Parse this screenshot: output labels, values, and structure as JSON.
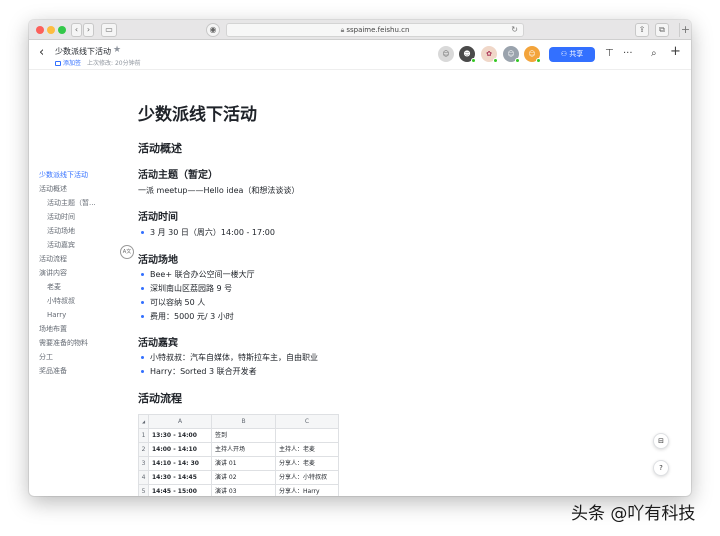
{
  "browser": {
    "url": "sspaime.feishu.cn"
  },
  "header": {
    "title": "少数派线下活动",
    "tag": "添加签",
    "last_modified": "上次修改: 20分钟前",
    "share_label": "共享"
  },
  "outline": [
    {
      "label": "少数派线下活动",
      "level": 1,
      "active": true
    },
    {
      "label": "活动概述",
      "level": 1
    },
    {
      "label": "活动主题（暂...",
      "level": 2
    },
    {
      "label": "活动时间",
      "level": 2
    },
    {
      "label": "活动场地",
      "level": 2
    },
    {
      "label": "活动嘉宾",
      "level": 2
    },
    {
      "label": "活动流程",
      "level": 1
    },
    {
      "label": "演讲内容",
      "level": 1
    },
    {
      "label": "老麦",
      "level": 2
    },
    {
      "label": "小特叔叔",
      "level": 2
    },
    {
      "label": "Harry",
      "level": 2
    },
    {
      "label": "场地布置",
      "level": 1
    },
    {
      "label": "需要准备的物料",
      "level": 1
    },
    {
      "label": "分工",
      "level": 1
    },
    {
      "label": "奖品准备",
      "level": 1
    }
  ],
  "doc": {
    "title": "少数派线下活动",
    "overview_heading": "活动概述",
    "theme_heading": "活动主题（暂定）",
    "theme_text": "一派 meetup——Hello idea（和想法谈谈）",
    "time_heading": "活动时间",
    "time_text": "3 月 30 日（周六）14:00 - 17:00",
    "venue_heading": "活动场地",
    "venue_items": [
      "Bee+ 联合办公空间一楼大厅",
      "深圳南山区荔园路 9 号",
      "可以容纳 50 人",
      "费用：5000 元/ 3 小时"
    ],
    "guests_heading": "活动嘉宾",
    "guest_items": [
      "小特叔叔：汽车自媒体，特斯拉车主，自由职业",
      "Harry：Sorted 3 联合开发者"
    ],
    "flow_heading": "活动流程",
    "ai_badge": "A文"
  },
  "sheet": {
    "columns": [
      "A",
      "B",
      "C"
    ],
    "rows": [
      {
        "n": "1",
        "a": "13:30 - 14:00",
        "b": "签到",
        "c": ""
      },
      {
        "n": "2",
        "a": "14:00 - 14:10",
        "b": "主持人开场",
        "c": "主持人：老麦"
      },
      {
        "n": "3",
        "a": "14:10 - 14: 30",
        "b": "演讲 01",
        "c": "分享人：老麦"
      },
      {
        "n": "4",
        "a": "14:30 - 14:45",
        "b": "演讲 02",
        "c": "分享人：小特叔叔"
      },
      {
        "n": "5",
        "a": "14:45 - 15:00",
        "b": "演讲 03",
        "c": "分享人：Harry"
      }
    ]
  },
  "watermark": "头条 @吖有科技",
  "colors": {
    "accent": "#3370ff"
  }
}
